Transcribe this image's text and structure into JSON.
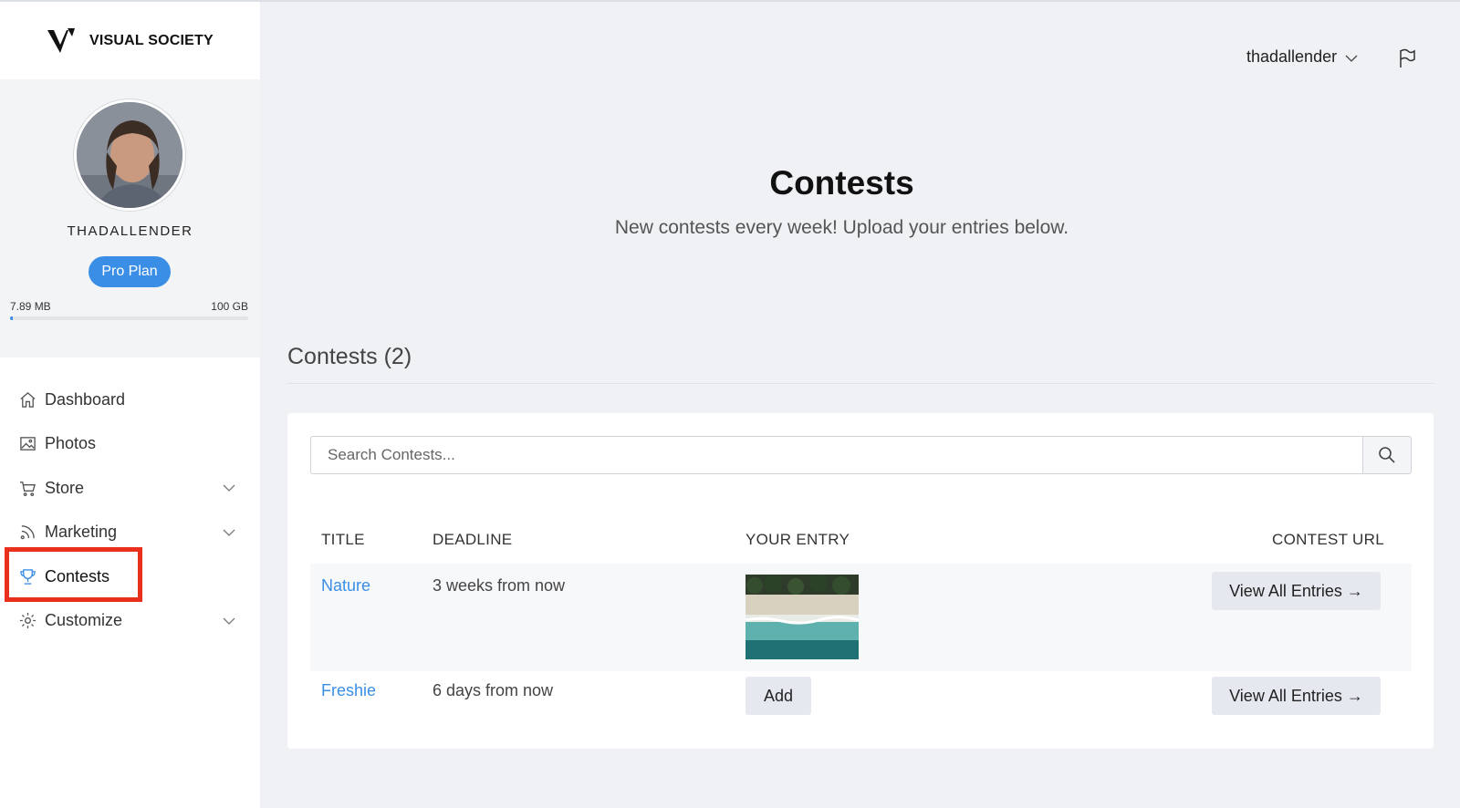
{
  "brand": {
    "name": "VISUAL SOCIETY"
  },
  "profile": {
    "username": "THADALLENDER",
    "plan": "Pro Plan",
    "storage_used": "7.89 MB",
    "storage_total": "100 GB",
    "storage_fraction": 0.0001
  },
  "nav": {
    "items": [
      {
        "label": "Dashboard",
        "icon": "home-icon",
        "expandable": false
      },
      {
        "label": "Photos",
        "icon": "image-icon",
        "expandable": false
      },
      {
        "label": "Store",
        "icon": "cart-icon",
        "expandable": true
      },
      {
        "label": "Marketing",
        "icon": "rss-icon",
        "expandable": true
      },
      {
        "label": "Contests",
        "icon": "trophy-icon",
        "expandable": false,
        "active": true
      },
      {
        "label": "Customize",
        "icon": "gear-icon",
        "expandable": true
      }
    ]
  },
  "header": {
    "user": "thadallender"
  },
  "page": {
    "title": "Contests",
    "subtitle": "New contests every week! Upload your entries below."
  },
  "contests": {
    "section_title": "Contests (2)",
    "search_placeholder": "Search Contests...",
    "columns": {
      "title": "TITLE",
      "deadline": "DEADLINE",
      "entry": "YOUR ENTRY",
      "url": "CONTEST URL"
    },
    "rows": [
      {
        "title": "Nature",
        "deadline": "3 weeks from now",
        "entry": "thumbnail",
        "action": "View All Entries →"
      },
      {
        "title": "Freshie",
        "deadline": "6 days from now",
        "entry_button": "Add",
        "action": "View All Entries →"
      }
    ]
  },
  "colors": {
    "accent": "#3a8ee6",
    "highlight": "#e8301c",
    "background": "#eff1f5"
  }
}
